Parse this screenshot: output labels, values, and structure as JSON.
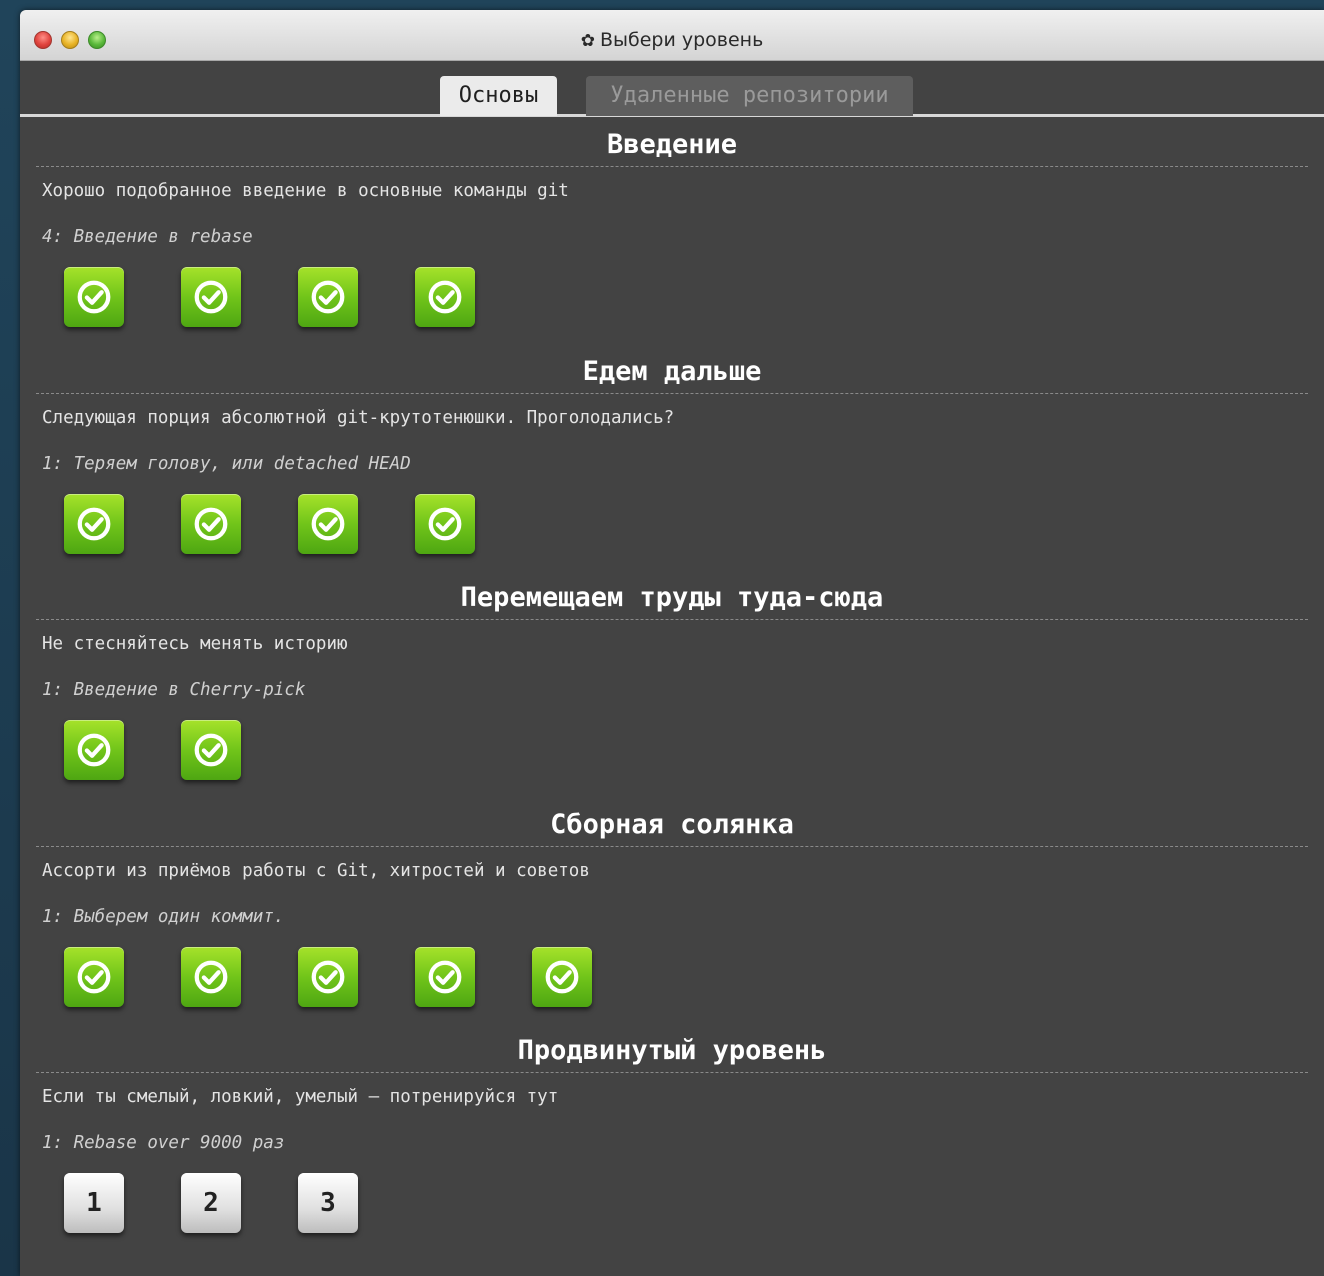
{
  "window": {
    "title": "Выбери уровень",
    "title_icon": "gear-icon"
  },
  "tabs": [
    {
      "label": "Основы",
      "active": true
    },
    {
      "label": "Удаленные репозитории",
      "active": false
    }
  ],
  "sections": [
    {
      "title": "Введение",
      "description": "Хорошо подобранное введение в основные команды git",
      "current_level": "4: Введение в rebase",
      "levels": [
        {
          "state": "done",
          "icon": "check-icon"
        },
        {
          "state": "done",
          "icon": "check-icon"
        },
        {
          "state": "done",
          "icon": "check-icon"
        },
        {
          "state": "done",
          "icon": "check-icon"
        }
      ]
    },
    {
      "title": "Едем дальше",
      "description": "Следующая порция абсолютной git-крутотенюшки. Проголодались?",
      "current_level": "1: Теряем голову, или detached HEAD",
      "levels": [
        {
          "state": "done",
          "icon": "check-icon"
        },
        {
          "state": "done",
          "icon": "check-icon"
        },
        {
          "state": "done",
          "icon": "check-icon"
        },
        {
          "state": "done",
          "icon": "check-icon"
        }
      ]
    },
    {
      "title": "Перемещаем труды туда-сюда",
      "description": "Не стесняйтесь менять историю",
      "current_level": "1: Введение в Cherry-pick",
      "levels": [
        {
          "state": "done",
          "icon": "check-icon"
        },
        {
          "state": "done",
          "icon": "check-icon"
        }
      ]
    },
    {
      "title": "Сборная солянка",
      "description": "Ассорти из приёмов работы с Git, хитростей и советов",
      "current_level": "1: Выберем один коммит.",
      "levels": [
        {
          "state": "done",
          "icon": "check-icon"
        },
        {
          "state": "done",
          "icon": "check-icon"
        },
        {
          "state": "done",
          "icon": "check-icon"
        },
        {
          "state": "done",
          "icon": "check-icon"
        },
        {
          "state": "done",
          "icon": "check-icon"
        }
      ]
    },
    {
      "title": "Продвинутый уровень",
      "description": "Если ты смелый, ловкий, умелый — потренируйся тут",
      "current_level": "1: Rebase over 9000 раз",
      "levels": [
        {
          "state": "todo",
          "label": "1"
        },
        {
          "state": "todo",
          "label": "2"
        },
        {
          "state": "todo",
          "label": "3"
        }
      ]
    }
  ],
  "colors": {
    "background": "#434343",
    "level_done": "#71c51a",
    "level_todo": "#e0e0e0"
  }
}
